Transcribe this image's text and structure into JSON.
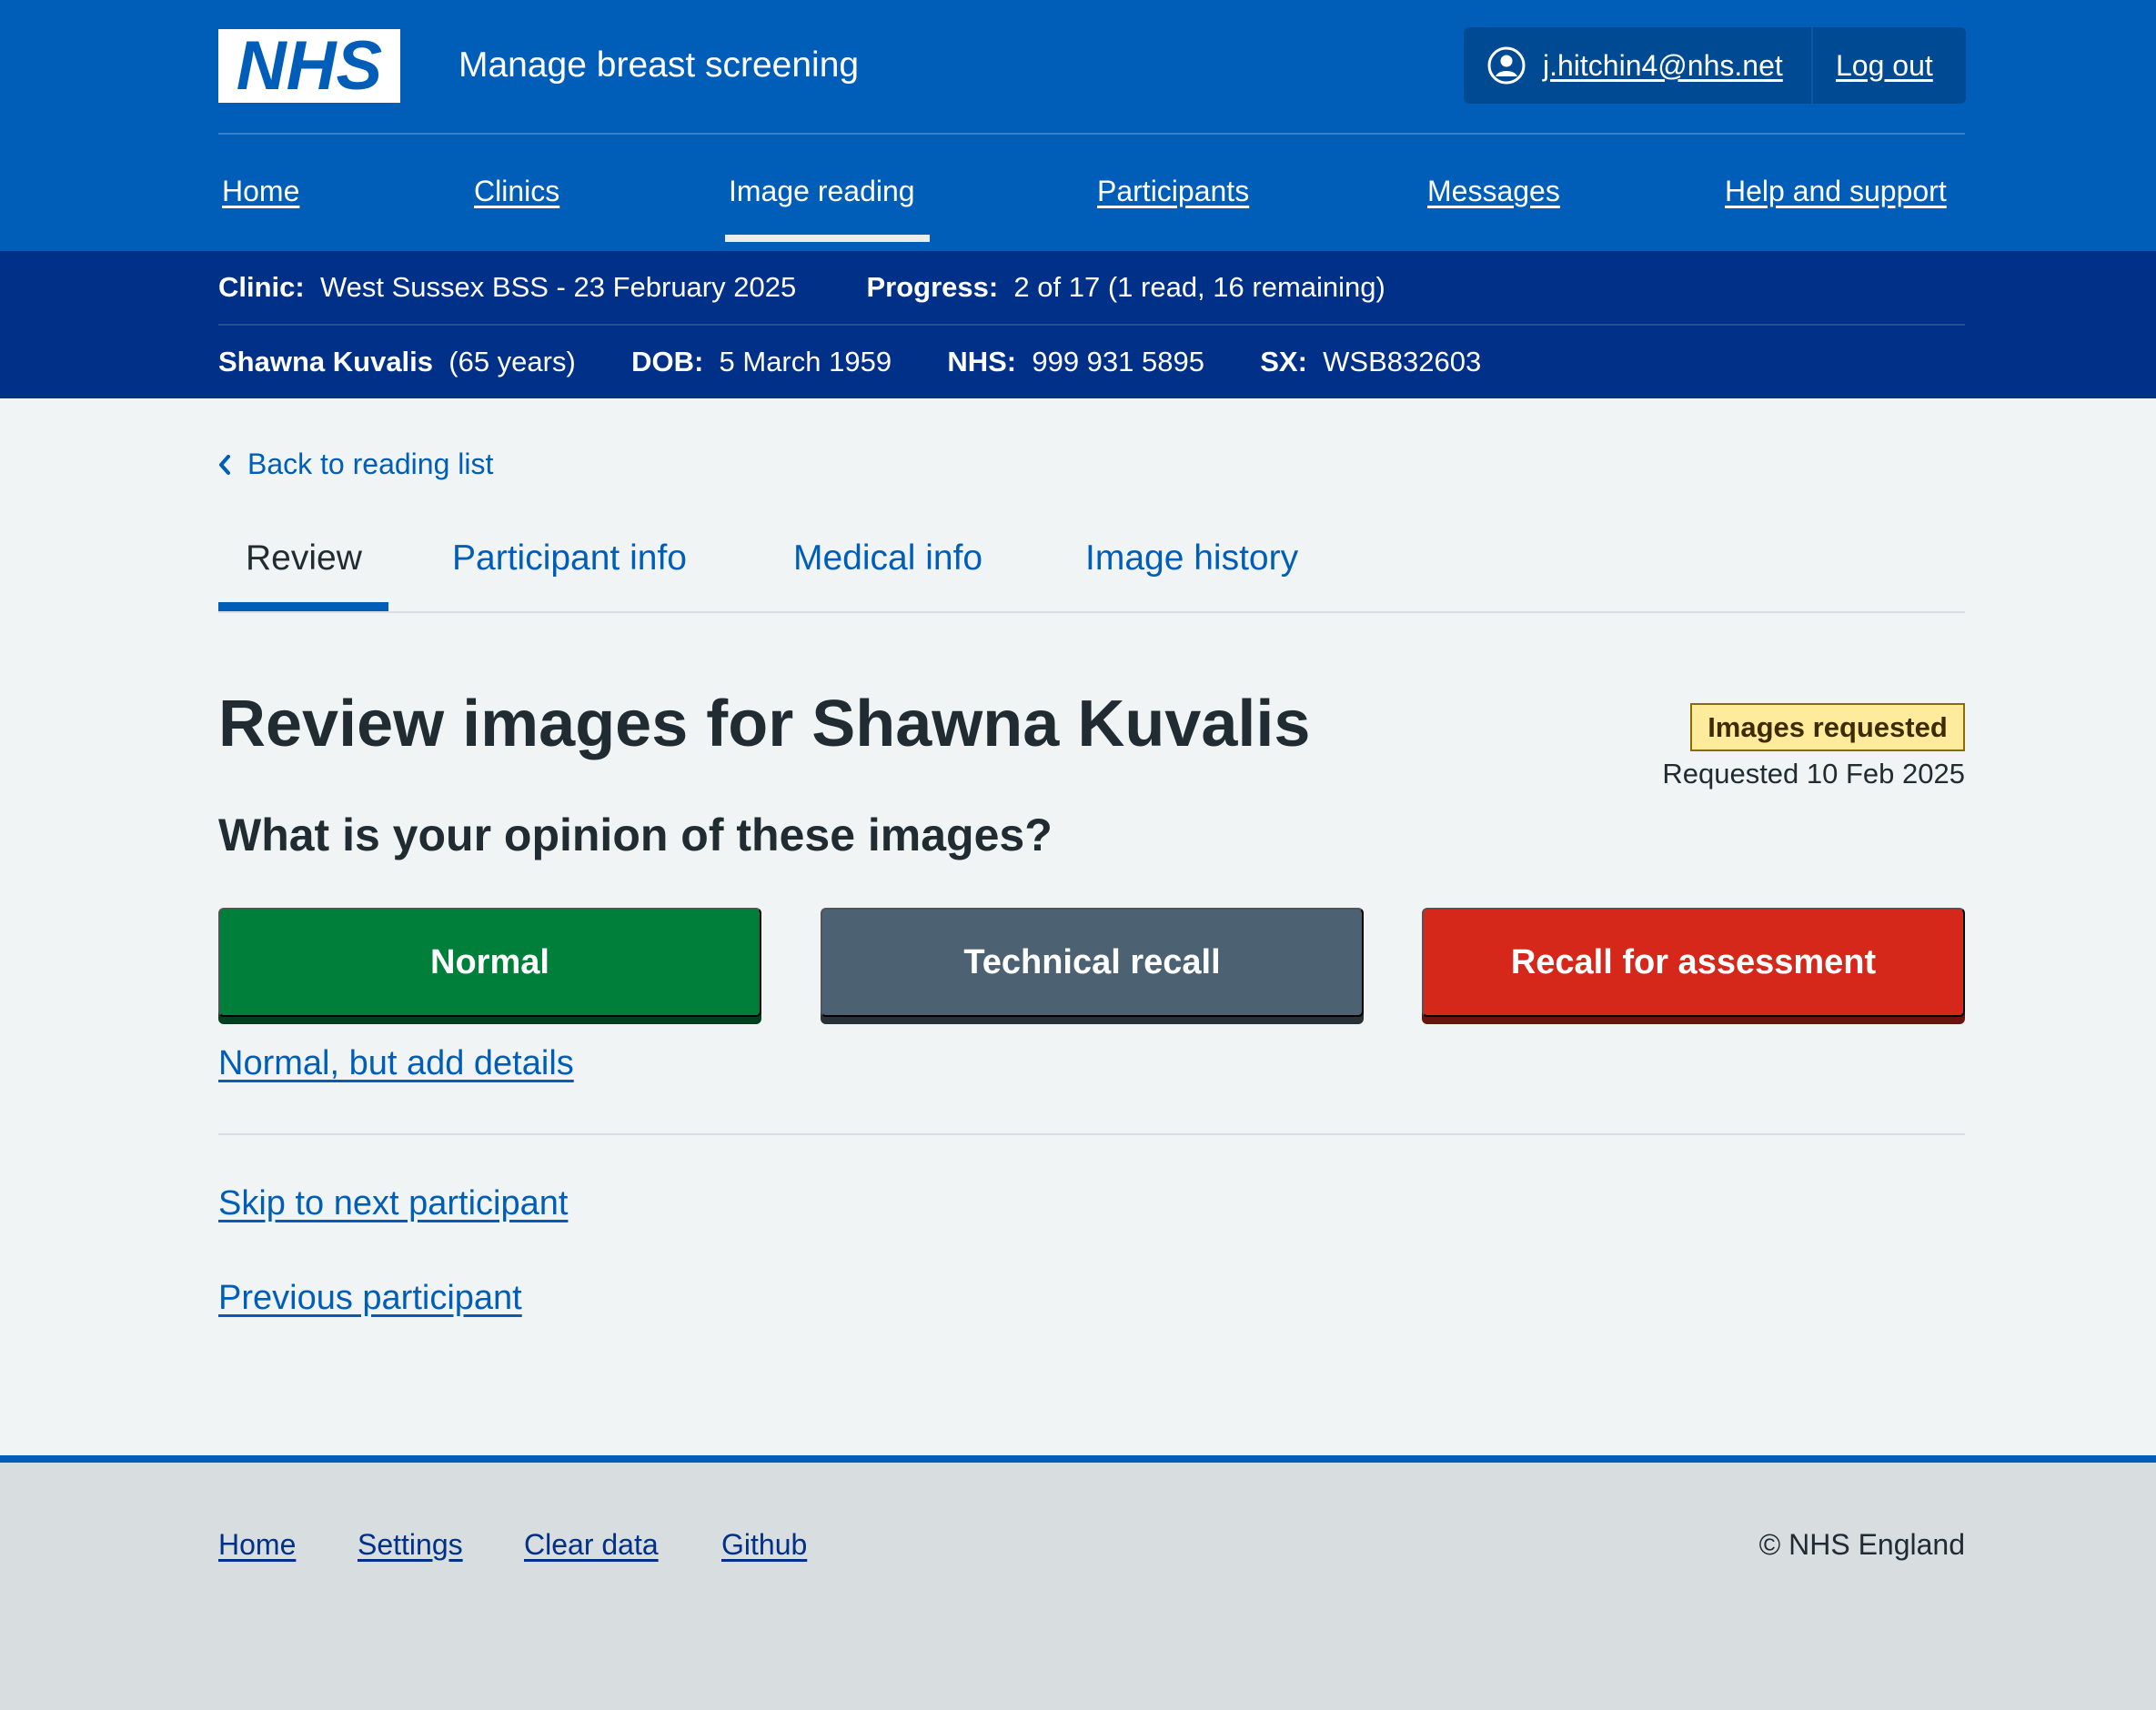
{
  "header": {
    "logo_text": "NHS",
    "service_name": "Manage breast screening",
    "user_email": "j.hitchin4@nhs.net",
    "logout_label": "Log out"
  },
  "nav": {
    "items": [
      {
        "label": "Home",
        "current": false
      },
      {
        "label": "Clinics",
        "current": false
      },
      {
        "label": "Image reading",
        "current": true
      },
      {
        "label": "Participants",
        "current": false
      },
      {
        "label": "Messages",
        "current": false
      },
      {
        "label": "Help and support",
        "current": false
      }
    ]
  },
  "context": {
    "clinic_label": "Clinic:",
    "clinic_value": "West Sussex BSS - 23 February 2025",
    "progress_label": "Progress:",
    "progress_value": "2 of 17 (1 read, 16 remaining)",
    "participant_name": "Shawna Kuvalis",
    "participant_age": "(65 years)",
    "dob_label": "DOB:",
    "dob_value": "5 March 1959",
    "nhs_label": "NHS:",
    "nhs_value": "999 931 5895",
    "sx_label": "SX:",
    "sx_value": "WSB832603"
  },
  "back_link": "Back to reading list",
  "tabs": [
    {
      "label": "Review",
      "current": true
    },
    {
      "label": "Participant info",
      "current": false
    },
    {
      "label": "Medical info",
      "current": false
    },
    {
      "label": "Image history",
      "current": false
    }
  ],
  "page": {
    "title": "Review images for Shawna Kuvalis",
    "status_tag": "Images requested",
    "requested_text": "Requested 10 Feb 2025",
    "question": "What is your opinion of these images?"
  },
  "actions": {
    "normal": "Normal",
    "technical_recall": "Technical recall",
    "recall_for_assessment": "Recall for assessment",
    "normal_add_details": "Normal, but add details",
    "skip_next": "Skip to next participant",
    "previous": "Previous participant"
  },
  "colors": {
    "brand_blue": "#005eb8",
    "dark_blue": "#003087",
    "normal_green": "#007f3b",
    "technical_grey": "#4c6272",
    "recall_red": "#d5281b",
    "tag_yellow": "#ffeb9c"
  },
  "footer": {
    "links": [
      "Home",
      "Settings",
      "Clear data",
      "Github"
    ],
    "copyright": "© NHS England"
  }
}
